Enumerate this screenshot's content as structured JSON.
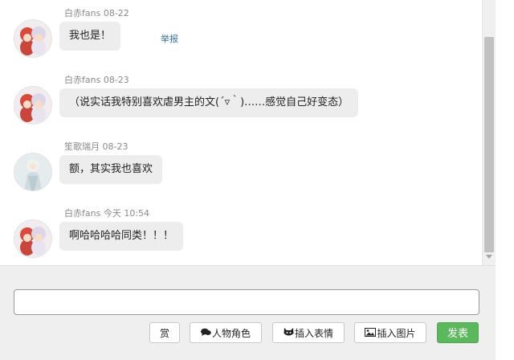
{
  "messages": [
    {
      "user": "白赤fans",
      "time": "08-22",
      "text": "我也是！",
      "report": "举报"
    },
    {
      "user": "白赤fans",
      "time": "08-23",
      "text": "（说实话我特别喜欢虐男主的文(´▿｀)……感觉自己好变态）"
    },
    {
      "user": "笙歌瑞月",
      "time": "08-23",
      "text": "额，其实我也喜欢"
    },
    {
      "user": "白赤fans",
      "time": "今天 10:54",
      "text": "啊哈哈哈哈同类！！！"
    }
  ],
  "composer": {
    "input_value": "",
    "reward_label": "赏",
    "character_label": "人物角色",
    "emoji_label": "插入表情",
    "image_label": "插入图片",
    "send_label": "发表"
  },
  "colors": {
    "bubble": "#ededed",
    "send": "#5cb85c",
    "link": "#3a6ea5"
  },
  "icons": [
    "chat-bubbles-icon",
    "cat-face-icon",
    "picture-icon"
  ]
}
